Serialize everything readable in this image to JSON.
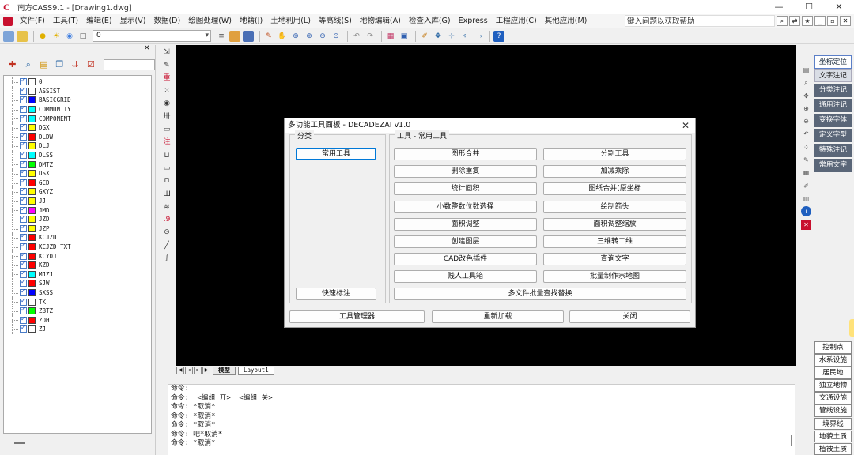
{
  "window": {
    "title": "南方CASS9.1 - [Drawing1.dwg]",
    "logo": "C",
    "controls": [
      "—",
      "☐",
      "✕"
    ]
  },
  "menu": {
    "items": [
      "文件(F)",
      "工具(T)",
      "编辑(E)",
      "显示(V)",
      "数据(D)",
      "绘图处理(W)",
      "地籍(J)",
      "土地利用(L)",
      "等高线(S)",
      "地物编辑(A)",
      "检查入库(G)",
      "Express",
      "工程应用(C)",
      "其他应用(M)"
    ],
    "help_text": "键入问题以获取帮助",
    "mdi_controls": [
      "_",
      "▫",
      "✕"
    ]
  },
  "toolbar": {
    "layer_value": "0"
  },
  "layers": [
    {
      "name": "0",
      "color": "#ffffff"
    },
    {
      "name": "ASSIST",
      "color": "#ffffff"
    },
    {
      "name": "BASICGRID",
      "color": "#0000ff"
    },
    {
      "name": "COMMUNITY",
      "color": "#00ffff"
    },
    {
      "name": "COMPONENT",
      "color": "#00ffff"
    },
    {
      "name": "DGX",
      "color": "#ffff00"
    },
    {
      "name": "DLDW",
      "color": "#ff0000"
    },
    {
      "name": "DLJ",
      "color": "#ffff00"
    },
    {
      "name": "DLSS",
      "color": "#00ffff"
    },
    {
      "name": "DMTZ",
      "color": "#00ff00"
    },
    {
      "name": "DSX",
      "color": "#ffff00"
    },
    {
      "name": "GCD",
      "color": "#ff0000"
    },
    {
      "name": "GXYZ",
      "color": "#ffff00"
    },
    {
      "name": "JJ",
      "color": "#ffff00"
    },
    {
      "name": "JMD",
      "color": "#ff00ff"
    },
    {
      "name": "JZD",
      "color": "#ffff00"
    },
    {
      "name": "JZP",
      "color": "#ffff00"
    },
    {
      "name": "KCJZD",
      "color": "#ff0000"
    },
    {
      "name": "KCJZD_TXT",
      "color": "#ff0000"
    },
    {
      "name": "KCYDJ",
      "color": "#ff0000"
    },
    {
      "name": "KZD",
      "color": "#ff0000"
    },
    {
      "name": "MJZJ",
      "color": "#00ffff"
    },
    {
      "name": "SJW",
      "color": "#ff0000"
    },
    {
      "name": "SXSS",
      "color": "#0000ff"
    },
    {
      "name": "TK",
      "color": "#ffffff"
    },
    {
      "name": "ZBTZ",
      "color": "#00ff00"
    },
    {
      "name": "ZDH",
      "color": "#ff0000"
    },
    {
      "name": "ZJ",
      "color": "#ffffff"
    }
  ],
  "vtools": [
    "⇲",
    "✎",
    "重",
    "⁙",
    "◉",
    "卅",
    "▭",
    "注",
    "⊔",
    "▭",
    "⊓",
    "Ш",
    "≋",
    ".9",
    "⊙",
    "╱",
    "∫"
  ],
  "tabs": {
    "model": "模型",
    "layout": "Layout1"
  },
  "command_lines": [
    "命令:",
    "命令:  <编组 开>  <编组 关>",
    "命令: *取消*",
    "命令: *取消*",
    "命令: *取消*",
    "命令: 吧*取消*",
    "命令: *取消*"
  ],
  "right_panel": {
    "top": [
      "坐标定位",
      "文字注记",
      "分类注记",
      "通用注记",
      "变换字体",
      "定义字型",
      "特殊注记",
      "常用文字"
    ],
    "bottom": [
      "控制点",
      "水系设施",
      "居民地",
      "独立地物",
      "交通设施",
      "管线设施",
      "境界线",
      "地貌土质",
      "植被土质"
    ]
  },
  "dialog": {
    "title": "多功能工具面板 - DECADEZAI v1.0",
    "close": "✕",
    "category_label": "分类",
    "tools_label": "工具 - 常用工具",
    "categories": [
      "常用工具",
      "快速标注"
    ],
    "tools": [
      "图形合并",
      "分割工具",
      "删除重复",
      "加减乘除",
      "统计面积",
      "图纸合并(原坐标",
      "小数整数位数选择",
      "绘制箭头",
      "面积调整",
      "面积调整缩放",
      "创建图层",
      "三维转二维",
      "CAD改色插件",
      "查询文字",
      "贱人工具箱",
      "批量制作宗地图"
    ],
    "wide_tool": "多文件批量查找替换",
    "footer": [
      "工具管理器",
      "重新加载",
      "关闭"
    ]
  },
  "colors": {
    "canvas": "#000000",
    "accent": "#0078d7",
    "brand": "#c8102e"
  }
}
